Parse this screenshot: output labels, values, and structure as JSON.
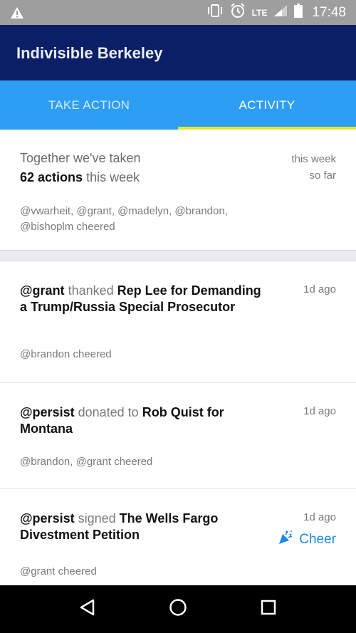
{
  "status_bar": {
    "network": "LTE",
    "time": "17:48",
    "icons": [
      "warning-icon",
      "vibrate-icon",
      "alarm-icon",
      "signal-icon",
      "battery-icon"
    ]
  },
  "app_bar": {
    "title": "Indivisible Berkeley"
  },
  "tabs": [
    {
      "label": "TAKE ACTION",
      "active": false
    },
    {
      "label": "ACTIVITY",
      "active": true
    }
  ],
  "summary": {
    "prefix": "Together we've taken",
    "count": "62 actions",
    "suffix": "this week",
    "when_line1": "this week",
    "when_line2": "so far",
    "cheered": "@vwarheit, @grant, @madelyn, @brandon, @bishoplm cheered"
  },
  "activities": [
    {
      "user": "@grant",
      "verb": "thanked",
      "target": "Rep Lee for Demanding a Trump/Russia Special Prosecutor",
      "ago": "1d ago",
      "cheered": "@brandon cheered"
    },
    {
      "user": "@persist",
      "verb": "donated to",
      "target": "Rob Quist for Montana",
      "ago": "1d ago",
      "cheered": "@brandon, @grant cheered"
    },
    {
      "user": "@persist",
      "verb": "signed",
      "target": "The Wells Fargo Divestment Petition",
      "ago": "1d ago",
      "cheered": "@grant cheered",
      "cheer_label": "Cheer"
    }
  ],
  "colors": {
    "app_bar": "#0b1f66",
    "tab_bar": "#2d9ef3",
    "tab_indicator": "#e9e62a",
    "cheer": "#1e88e5",
    "status_bar": "#9e9e9e"
  },
  "nav_icons": [
    "back-icon",
    "home-icon",
    "recents-icon"
  ]
}
